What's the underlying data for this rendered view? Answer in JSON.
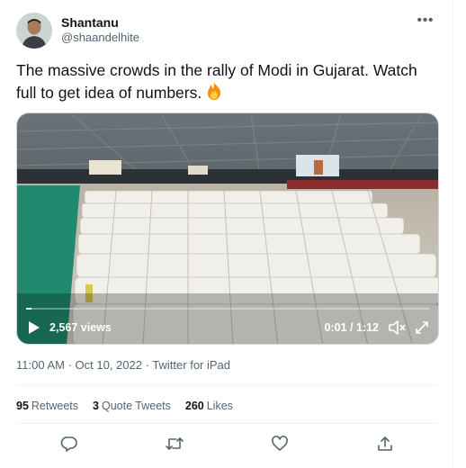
{
  "author": {
    "name": "Shantanu",
    "handle": "@shaandelhite"
  },
  "more_menu": {
    "label": "•••"
  },
  "tweet": {
    "text": "The massive crowds in the rally of Modi in Gujarat. Watch full to get idea of numbers.",
    "emoji": "fire"
  },
  "video": {
    "views": "2,567 views",
    "time": "0:01 / 1:12",
    "progress": 0.014
  },
  "meta": {
    "time": "11:00 AM",
    "separator": " · ",
    "date": "Oct 10, 2022",
    "source": "Twitter for iPad"
  },
  "stats": {
    "retweets_count": "95",
    "retweets_label": "Retweets",
    "quotes_count": "3",
    "quotes_label": "Quote Tweets",
    "likes_count": "260",
    "likes_label": "Likes"
  },
  "actions": [
    "reply-icon",
    "retweet-icon",
    "like-icon",
    "share-icon"
  ],
  "colors": {
    "text": "#0f1419",
    "secondary": "#536471",
    "border": "#eff3f4"
  }
}
